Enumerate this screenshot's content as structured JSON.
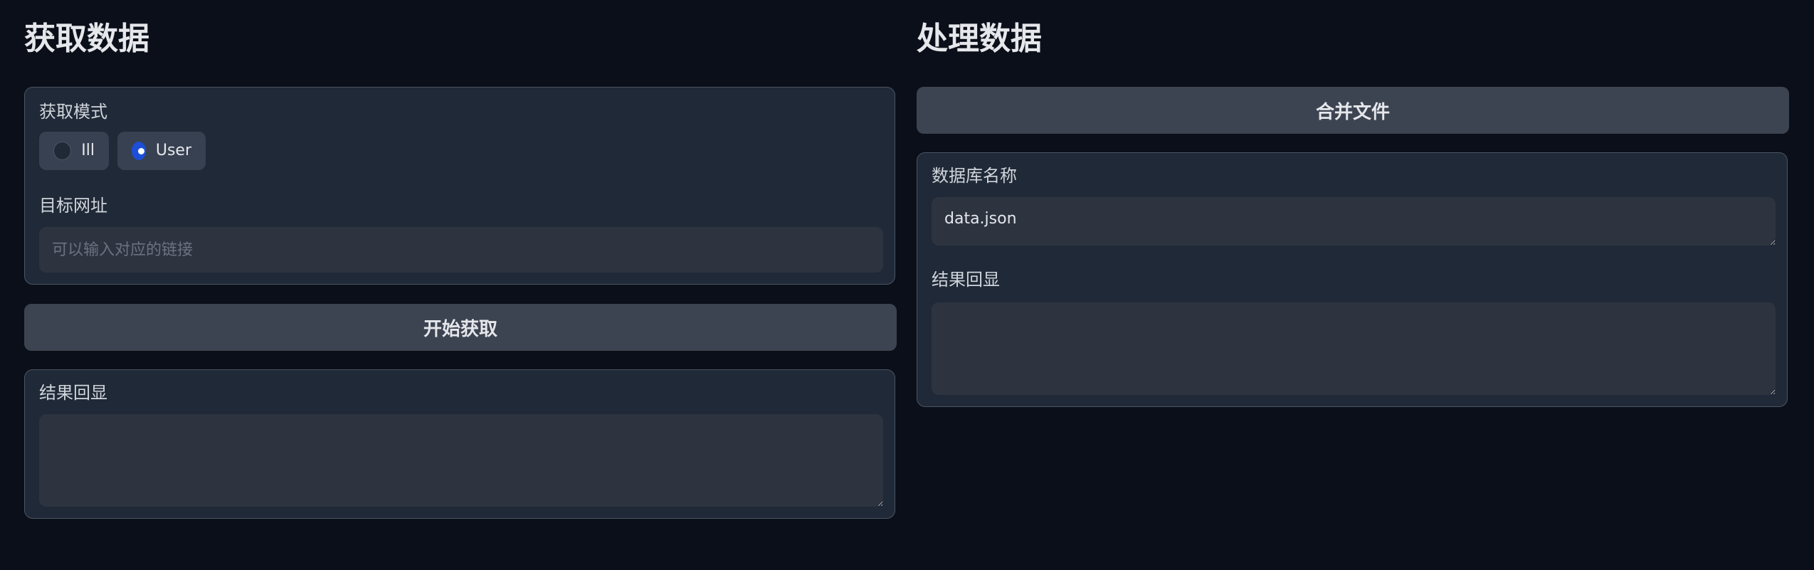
{
  "left": {
    "title": "获取数据",
    "mode_label": "获取模式",
    "mode_options": [
      {
        "label": "Ill",
        "selected": false
      },
      {
        "label": "User",
        "selected": true
      }
    ],
    "url_label": "目标网址",
    "url_placeholder": "可以输入对应的链接",
    "url_value": "",
    "start_button": "开始获取",
    "result_label": "结果回显",
    "result_value": ""
  },
  "right": {
    "title": "处理数据",
    "merge_button": "合并文件",
    "db_label": "数据库名称",
    "db_value": "data.json",
    "result_label": "结果回显",
    "result_value": ""
  },
  "colors": {
    "background": "#0b0f19",
    "panel": "#1f2937",
    "accent": "#1d4ed8"
  }
}
